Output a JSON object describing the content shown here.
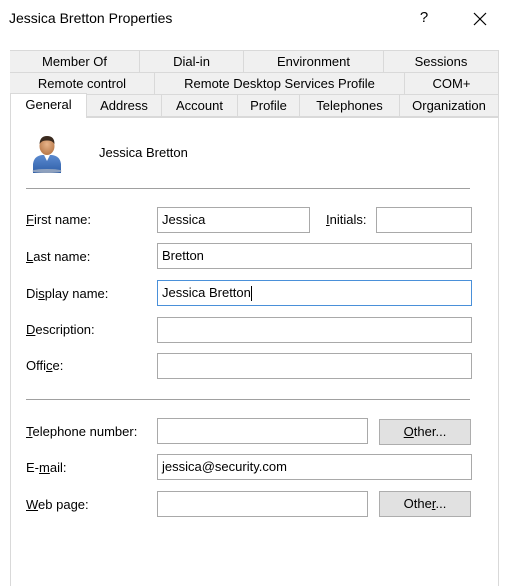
{
  "window": {
    "title": "Jessica Bretton Properties",
    "help_glyph": "?"
  },
  "tabs": {
    "row1": [
      "Member Of",
      "Dial-in",
      "Environment",
      "Sessions"
    ],
    "row2": [
      "Remote control",
      "Remote Desktop Services Profile",
      "COM+"
    ],
    "row3": [
      "General",
      "Address",
      "Account",
      "Profile",
      "Telephones",
      "Organization"
    ],
    "active": "General"
  },
  "general": {
    "user_display": "Jessica Bretton",
    "labels": {
      "first_name": "First name:",
      "initials": "Initials:",
      "last_name": "Last name:",
      "display_name": "Display name:",
      "description": "Description:",
      "office": "Office:",
      "telephone": "Telephone number:",
      "email": "E-mail:",
      "web_page": "Web page:"
    },
    "values": {
      "first_name": "Jessica",
      "initials": "",
      "last_name": "Bretton",
      "display_name": "Jessica Bretton",
      "description": "",
      "office": "",
      "telephone": "",
      "email": "jessica@security.com",
      "web_page": ""
    },
    "buttons": {
      "other_phone": "Other...",
      "other_web": "Other..."
    }
  }
}
